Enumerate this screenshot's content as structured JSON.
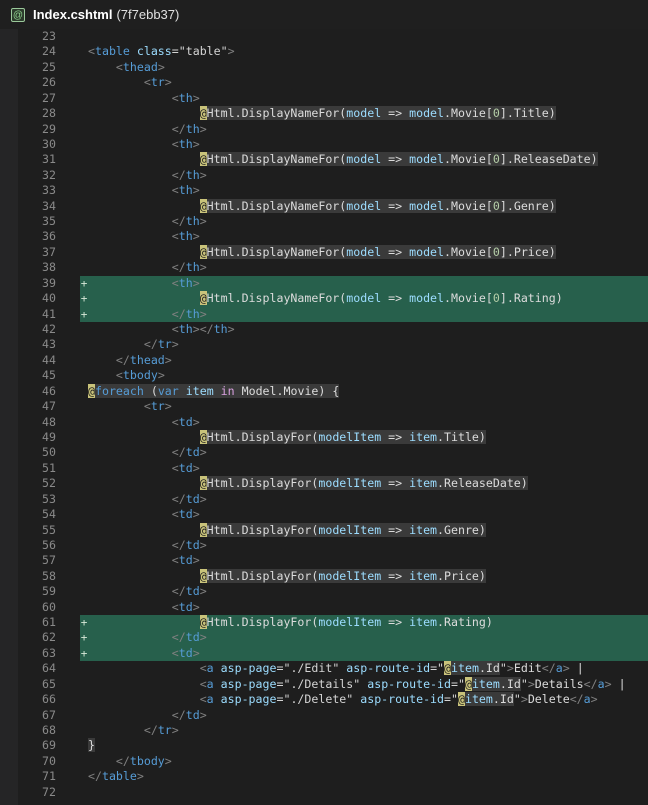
{
  "tab": {
    "filename": "Index.cshtml",
    "hash": "(7f7ebb37)",
    "icon": "razor-file-icon"
  },
  "colors": {
    "added_bg": "#27604c",
    "background": "#1e1e1e"
  },
  "lines": [
    {
      "n": "23",
      "added": false,
      "tokens": []
    },
    {
      "n": "24",
      "added": false,
      "tokens": [
        [
          "p",
          "<"
        ],
        [
          "t",
          "table"
        ],
        [
          "",
          ""
        ],
        [
          "a",
          " class"
        ],
        [
          "s",
          "=\"table\""
        ],
        [
          "p",
          ">"
        ]
      ]
    },
    {
      "n": "25",
      "added": false,
      "tokens": [
        [
          "",
          "    "
        ],
        [
          "p",
          "<"
        ],
        [
          "t",
          "thead"
        ],
        [
          "p",
          ">"
        ]
      ]
    },
    {
      "n": "26",
      "added": false,
      "tokens": [
        [
          "",
          "        "
        ],
        [
          "p",
          "<"
        ],
        [
          "t",
          "tr"
        ],
        [
          "p",
          ">"
        ]
      ]
    },
    {
      "n": "27",
      "added": false,
      "tokens": [
        [
          "",
          "            "
        ],
        [
          "p",
          "<"
        ],
        [
          "t",
          "th"
        ],
        [
          "p",
          ">"
        ]
      ]
    },
    {
      "n": "28",
      "added": false,
      "tokens": [
        [
          "",
          "                "
        ],
        [
          "at",
          "@"
        ],
        [
          "rz w",
          "Html.DisplayNameFor("
        ],
        [
          "rz v",
          "model"
        ],
        [
          "rz w",
          " => "
        ],
        [
          "rz v",
          "model"
        ],
        [
          "rz w",
          ".Movie["
        ],
        [
          "rz n",
          "0"
        ],
        [
          "rz w",
          "].Title)"
        ]
      ]
    },
    {
      "n": "29",
      "added": false,
      "tokens": [
        [
          "",
          "            "
        ],
        [
          "p",
          "</"
        ],
        [
          "t",
          "th"
        ],
        [
          "p",
          ">"
        ]
      ]
    },
    {
      "n": "30",
      "added": false,
      "tokens": [
        [
          "",
          "            "
        ],
        [
          "p",
          "<"
        ],
        [
          "t",
          "th"
        ],
        [
          "p",
          ">"
        ]
      ]
    },
    {
      "n": "31",
      "added": false,
      "tokens": [
        [
          "",
          "                "
        ],
        [
          "at",
          "@"
        ],
        [
          "rz w",
          "Html.DisplayNameFor("
        ],
        [
          "rz v",
          "model"
        ],
        [
          "rz w",
          " => "
        ],
        [
          "rz v",
          "model"
        ],
        [
          "rz w",
          ".Movie["
        ],
        [
          "rz n",
          "0"
        ],
        [
          "rz w",
          "].ReleaseDate)"
        ]
      ]
    },
    {
      "n": "32",
      "added": false,
      "tokens": [
        [
          "",
          "            "
        ],
        [
          "p",
          "</"
        ],
        [
          "t",
          "th"
        ],
        [
          "p",
          ">"
        ]
      ]
    },
    {
      "n": "33",
      "added": false,
      "tokens": [
        [
          "",
          "            "
        ],
        [
          "p",
          "<"
        ],
        [
          "t",
          "th"
        ],
        [
          "p",
          ">"
        ]
      ]
    },
    {
      "n": "34",
      "added": false,
      "tokens": [
        [
          "",
          "                "
        ],
        [
          "at",
          "@"
        ],
        [
          "rz w",
          "Html.DisplayNameFor("
        ],
        [
          "rz v",
          "model"
        ],
        [
          "rz w",
          " => "
        ],
        [
          "rz v",
          "model"
        ],
        [
          "rz w",
          ".Movie["
        ],
        [
          "rz n",
          "0"
        ],
        [
          "rz w",
          "].Genre)"
        ]
      ]
    },
    {
      "n": "35",
      "added": false,
      "tokens": [
        [
          "",
          "            "
        ],
        [
          "p",
          "</"
        ],
        [
          "t",
          "th"
        ],
        [
          "p",
          ">"
        ]
      ]
    },
    {
      "n": "36",
      "added": false,
      "tokens": [
        [
          "",
          "            "
        ],
        [
          "p",
          "<"
        ],
        [
          "t",
          "th"
        ],
        [
          "p",
          ">"
        ]
      ]
    },
    {
      "n": "37",
      "added": false,
      "tokens": [
        [
          "",
          "                "
        ],
        [
          "at",
          "@"
        ],
        [
          "rz w",
          "Html.DisplayNameFor("
        ],
        [
          "rz v",
          "model"
        ],
        [
          "rz w",
          " => "
        ],
        [
          "rz v",
          "model"
        ],
        [
          "rz w",
          ".Movie["
        ],
        [
          "rz n",
          "0"
        ],
        [
          "rz w",
          "].Price)"
        ]
      ]
    },
    {
      "n": "38",
      "added": false,
      "tokens": [
        [
          "",
          "            "
        ],
        [
          "p",
          "</"
        ],
        [
          "t",
          "th"
        ],
        [
          "p",
          ">"
        ]
      ]
    },
    {
      "n": "39",
      "added": true,
      "tokens": [
        [
          "",
          "            "
        ],
        [
          "p",
          "<"
        ],
        [
          "t",
          "th"
        ],
        [
          "p",
          ">"
        ]
      ]
    },
    {
      "n": "40",
      "added": true,
      "tokens": [
        [
          "",
          "                "
        ],
        [
          "at",
          "@"
        ],
        [
          "w",
          "Html.DisplayNameFor("
        ],
        [
          "v",
          "model"
        ],
        [
          "w",
          " => "
        ],
        [
          "v",
          "model"
        ],
        [
          "w",
          ".Movie["
        ],
        [
          "n",
          "0"
        ],
        [
          "w",
          "].Rating)"
        ]
      ]
    },
    {
      "n": "41",
      "added": true,
      "tokens": [
        [
          "",
          "            "
        ],
        [
          "p",
          "</"
        ],
        [
          "t",
          "th"
        ],
        [
          "p",
          ">"
        ]
      ]
    },
    {
      "n": "42",
      "added": false,
      "tokens": [
        [
          "",
          "            "
        ],
        [
          "p",
          "<"
        ],
        [
          "t",
          "th"
        ],
        [
          "p",
          "></"
        ],
        [
          "t",
          "th"
        ],
        [
          "p",
          ">"
        ]
      ]
    },
    {
      "n": "43",
      "added": false,
      "tokens": [
        [
          "",
          "        "
        ],
        [
          "p",
          "</"
        ],
        [
          "t",
          "tr"
        ],
        [
          "p",
          ">"
        ]
      ]
    },
    {
      "n": "44",
      "added": false,
      "tokens": [
        [
          "",
          "    "
        ],
        [
          "p",
          "</"
        ],
        [
          "t",
          "thead"
        ],
        [
          "p",
          ">"
        ]
      ]
    },
    {
      "n": "45",
      "added": false,
      "tokens": [
        [
          "",
          "    "
        ],
        [
          "p",
          "<"
        ],
        [
          "t",
          "tbody"
        ],
        [
          "p",
          ">"
        ]
      ]
    },
    {
      "n": "46",
      "added": false,
      "tokens": [
        [
          "at",
          "@"
        ],
        [
          "rz k",
          "foreach"
        ],
        [
          "rz w",
          " ("
        ],
        [
          "rz k",
          "var"
        ],
        [
          "rz v",
          " item"
        ],
        [
          "rz kp",
          " in"
        ],
        [
          "rz w",
          " Model.Movie) {"
        ]
      ]
    },
    {
      "n": "47",
      "added": false,
      "tokens": [
        [
          "",
          "        "
        ],
        [
          "p",
          "<"
        ],
        [
          "t",
          "tr"
        ],
        [
          "p",
          ">"
        ]
      ]
    },
    {
      "n": "48",
      "added": false,
      "tokens": [
        [
          "",
          "            "
        ],
        [
          "p",
          "<"
        ],
        [
          "t",
          "td"
        ],
        [
          "p",
          ">"
        ]
      ]
    },
    {
      "n": "49",
      "added": false,
      "tokens": [
        [
          "",
          "                "
        ],
        [
          "at",
          "@"
        ],
        [
          "rz w",
          "Html.DisplayFor("
        ],
        [
          "rz v",
          "modelItem"
        ],
        [
          "rz w",
          " => "
        ],
        [
          "rz v",
          "item"
        ],
        [
          "rz w",
          ".Title)"
        ]
      ]
    },
    {
      "n": "50",
      "added": false,
      "tokens": [
        [
          "",
          "            "
        ],
        [
          "p",
          "</"
        ],
        [
          "t",
          "td"
        ],
        [
          "p",
          ">"
        ]
      ]
    },
    {
      "n": "51",
      "added": false,
      "tokens": [
        [
          "",
          "            "
        ],
        [
          "p",
          "<"
        ],
        [
          "t",
          "td"
        ],
        [
          "p",
          ">"
        ]
      ]
    },
    {
      "n": "52",
      "added": false,
      "tokens": [
        [
          "",
          "                "
        ],
        [
          "at",
          "@"
        ],
        [
          "rz w",
          "Html.DisplayFor("
        ],
        [
          "rz v",
          "modelItem"
        ],
        [
          "rz w",
          " => "
        ],
        [
          "rz v",
          "item"
        ],
        [
          "rz w",
          ".ReleaseDate)"
        ]
      ]
    },
    {
      "n": "53",
      "added": false,
      "tokens": [
        [
          "",
          "            "
        ],
        [
          "p",
          "</"
        ],
        [
          "t",
          "td"
        ],
        [
          "p",
          ">"
        ]
      ]
    },
    {
      "n": "54",
      "added": false,
      "tokens": [
        [
          "",
          "            "
        ],
        [
          "p",
          "<"
        ],
        [
          "t",
          "td"
        ],
        [
          "p",
          ">"
        ]
      ]
    },
    {
      "n": "55",
      "added": false,
      "tokens": [
        [
          "",
          "                "
        ],
        [
          "at",
          "@"
        ],
        [
          "rz w",
          "Html.DisplayFor("
        ],
        [
          "rz v",
          "modelItem"
        ],
        [
          "rz w",
          " => "
        ],
        [
          "rz v",
          "item"
        ],
        [
          "rz w",
          ".Genre)"
        ]
      ]
    },
    {
      "n": "56",
      "added": false,
      "tokens": [
        [
          "",
          "            "
        ],
        [
          "p",
          "</"
        ],
        [
          "t",
          "td"
        ],
        [
          "p",
          ">"
        ]
      ]
    },
    {
      "n": "57",
      "added": false,
      "tokens": [
        [
          "",
          "            "
        ],
        [
          "p",
          "<"
        ],
        [
          "t",
          "td"
        ],
        [
          "p",
          ">"
        ]
      ]
    },
    {
      "n": "58",
      "added": false,
      "tokens": [
        [
          "",
          "                "
        ],
        [
          "at",
          "@"
        ],
        [
          "rz w",
          "Html.DisplayFor("
        ],
        [
          "rz v",
          "modelItem"
        ],
        [
          "rz w",
          " => "
        ],
        [
          "rz v",
          "item"
        ],
        [
          "rz w",
          ".Price)"
        ]
      ]
    },
    {
      "n": "59",
      "added": false,
      "tokens": [
        [
          "",
          "            "
        ],
        [
          "p",
          "</"
        ],
        [
          "t",
          "td"
        ],
        [
          "p",
          ">"
        ]
      ]
    },
    {
      "n": "60",
      "added": false,
      "tokens": [
        [
          "",
          "            "
        ],
        [
          "p",
          "<"
        ],
        [
          "t",
          "td"
        ],
        [
          "p",
          ">"
        ]
      ]
    },
    {
      "n": "61",
      "added": true,
      "tokens": [
        [
          "",
          "                "
        ],
        [
          "at",
          "@"
        ],
        [
          "w",
          "Html.DisplayFor("
        ],
        [
          "v",
          "modelItem"
        ],
        [
          "w",
          " => "
        ],
        [
          "v",
          "item"
        ],
        [
          "w",
          ".Rating)"
        ]
      ]
    },
    {
      "n": "62",
      "added": true,
      "tokens": [
        [
          "",
          "            "
        ],
        [
          "p",
          "</"
        ],
        [
          "t",
          "td"
        ],
        [
          "p",
          ">"
        ]
      ]
    },
    {
      "n": "63",
      "added": true,
      "tokens": [
        [
          "",
          "            "
        ],
        [
          "p",
          "<"
        ],
        [
          "t",
          "td"
        ],
        [
          "p",
          ">"
        ]
      ]
    },
    {
      "n": "64",
      "added": false,
      "tokens": [
        [
          "",
          "                "
        ],
        [
          "p",
          "<"
        ],
        [
          "t",
          "a"
        ],
        [
          "a",
          " asp-page"
        ],
        [
          "s",
          "=\"./Edit\""
        ],
        [
          "a",
          " asp-route-id"
        ],
        [
          "s",
          "=\""
        ],
        [
          "at",
          "@"
        ],
        [
          "rz v",
          "item"
        ],
        [
          "rz w",
          ".Id"
        ],
        [
          "s",
          "\""
        ],
        [
          "p",
          ">"
        ],
        [
          "w",
          "Edit"
        ],
        [
          "p",
          "</"
        ],
        [
          "t",
          "a"
        ],
        [
          "p",
          ">"
        ],
        [
          "w",
          " |"
        ]
      ]
    },
    {
      "n": "65",
      "added": false,
      "tokens": [
        [
          "",
          "                "
        ],
        [
          "p",
          "<"
        ],
        [
          "t",
          "a"
        ],
        [
          "a",
          " asp-page"
        ],
        [
          "s",
          "=\"./Details\""
        ],
        [
          "a",
          " asp-route-id"
        ],
        [
          "s",
          "=\""
        ],
        [
          "at",
          "@"
        ],
        [
          "rz v",
          "item"
        ],
        [
          "rz w",
          ".Id"
        ],
        [
          "s",
          "\""
        ],
        [
          "p",
          ">"
        ],
        [
          "w",
          "Details"
        ],
        [
          "p",
          "</"
        ],
        [
          "t",
          "a"
        ],
        [
          "p",
          ">"
        ],
        [
          "w",
          " |"
        ]
      ]
    },
    {
      "n": "66",
      "added": false,
      "tokens": [
        [
          "",
          "                "
        ],
        [
          "p",
          "<"
        ],
        [
          "t",
          "a"
        ],
        [
          "a",
          " asp-page"
        ],
        [
          "s",
          "=\"./Delete\""
        ],
        [
          "a",
          " asp-route-id"
        ],
        [
          "s",
          "=\""
        ],
        [
          "at",
          "@"
        ],
        [
          "rz v",
          "item"
        ],
        [
          "rz w",
          ".Id"
        ],
        [
          "s",
          "\""
        ],
        [
          "p",
          ">"
        ],
        [
          "w",
          "Delete"
        ],
        [
          "p",
          "</"
        ],
        [
          "t",
          "a"
        ],
        [
          "p",
          ">"
        ]
      ]
    },
    {
      "n": "67",
      "added": false,
      "tokens": [
        [
          "",
          "            "
        ],
        [
          "p",
          "</"
        ],
        [
          "t",
          "td"
        ],
        [
          "p",
          ">"
        ]
      ]
    },
    {
      "n": "68",
      "added": false,
      "tokens": [
        [
          "",
          "        "
        ],
        [
          "p",
          "</"
        ],
        [
          "t",
          "tr"
        ],
        [
          "p",
          ">"
        ]
      ]
    },
    {
      "n": "69",
      "added": false,
      "tokens": [
        [
          "rz w",
          "}"
        ]
      ]
    },
    {
      "n": "70",
      "added": false,
      "tokens": [
        [
          "",
          "    "
        ],
        [
          "p",
          "</"
        ],
        [
          "t",
          "tbody"
        ],
        [
          "p",
          ">"
        ]
      ]
    },
    {
      "n": "71",
      "added": false,
      "tokens": [
        [
          "p",
          "</"
        ],
        [
          "t",
          "table"
        ],
        [
          "p",
          ">"
        ]
      ]
    },
    {
      "n": "72",
      "added": false,
      "tokens": []
    }
  ]
}
